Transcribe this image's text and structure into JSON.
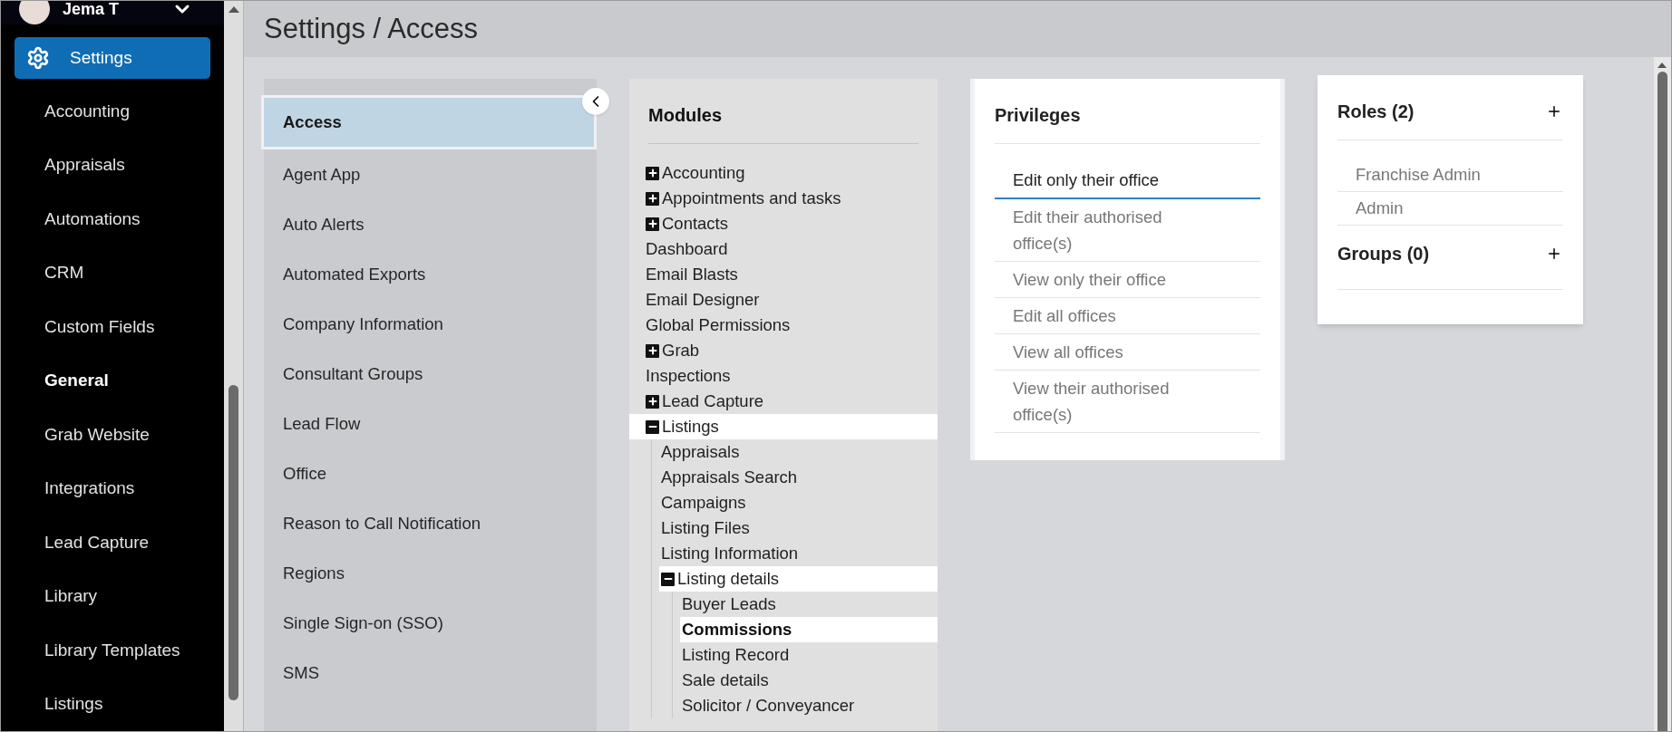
{
  "user": {
    "name": "Jema T"
  },
  "nav": {
    "header": {
      "label": "Settings",
      "selected": true
    },
    "items": [
      {
        "label": "Accounting",
        "selected": false
      },
      {
        "label": "Appraisals",
        "selected": false
      },
      {
        "label": "Automations",
        "selected": false
      },
      {
        "label": "CRM",
        "selected": false
      },
      {
        "label": "Custom Fields",
        "selected": false
      },
      {
        "label": "General",
        "selected": true
      },
      {
        "label": "Grab Website",
        "selected": false
      },
      {
        "label": "Integrations",
        "selected": false
      },
      {
        "label": "Lead Capture",
        "selected": false
      },
      {
        "label": "Library",
        "selected": false
      },
      {
        "label": "Library Templates",
        "selected": false
      },
      {
        "label": "Listings",
        "selected": false
      }
    ]
  },
  "page": {
    "title": "Settings / Access"
  },
  "settings_menu": {
    "items": [
      {
        "label": "Access",
        "selected": true
      },
      {
        "label": "Agent App",
        "selected": false
      },
      {
        "label": "Auto Alerts",
        "selected": false
      },
      {
        "label": "Automated Exports",
        "selected": false
      },
      {
        "label": "Company Information",
        "selected": false
      },
      {
        "label": "Consultant Groups",
        "selected": false
      },
      {
        "label": "Lead Flow",
        "selected": false
      },
      {
        "label": "Office",
        "selected": false
      },
      {
        "label": "Reason to Call Notification",
        "selected": false
      },
      {
        "label": "Regions",
        "selected": false
      },
      {
        "label": "Single Sign-on (SSO)",
        "selected": false
      },
      {
        "label": "SMS",
        "selected": false
      }
    ]
  },
  "modules": {
    "title": "Modules",
    "tree": [
      {
        "label": "Accounting",
        "expanded": false,
        "highlighted": false,
        "selected": false
      },
      {
        "label": "Appointments and tasks",
        "expanded": false,
        "highlighted": false,
        "selected": false
      },
      {
        "label": "Contacts",
        "expanded": false,
        "highlighted": false,
        "selected": false
      },
      {
        "label": "Dashboard",
        "highlighted": false,
        "selected": false
      },
      {
        "label": "Email Blasts",
        "highlighted": false,
        "selected": false
      },
      {
        "label": "Email Designer",
        "highlighted": false,
        "selected": false
      },
      {
        "label": "Global Permissions",
        "highlighted": false,
        "selected": false
      },
      {
        "label": "Grab",
        "expanded": false,
        "highlighted": false,
        "selected": false
      },
      {
        "label": "Inspections",
        "highlighted": false,
        "selected": false
      },
      {
        "label": "Lead Capture",
        "expanded": false,
        "highlighted": false,
        "selected": false
      },
      {
        "label": "Listings",
        "expanded": true,
        "highlighted": true,
        "selected": false,
        "children": [
          {
            "label": "Appraisals",
            "highlighted": false,
            "selected": false
          },
          {
            "label": "Appraisals Search",
            "highlighted": false,
            "selected": false
          },
          {
            "label": "Campaigns",
            "highlighted": false,
            "selected": false
          },
          {
            "label": "Listing Files",
            "highlighted": false,
            "selected": false
          },
          {
            "label": "Listing Information",
            "highlighted": false,
            "selected": false
          },
          {
            "label": "Listing details",
            "expanded": true,
            "highlighted": true,
            "selected": false,
            "children": [
              {
                "label": "Buyer Leads",
                "highlighted": false,
                "selected": false
              },
              {
                "label": "Commissions",
                "highlighted": true,
                "selected": true
              },
              {
                "label": "Listing Record",
                "highlighted": false,
                "selected": false
              },
              {
                "label": "Sale details",
                "highlighted": false,
                "selected": false
              },
              {
                "label": "Solicitor / Conveyancer",
                "highlighted": false,
                "selected": false
              }
            ]
          }
        ]
      }
    ]
  },
  "privileges": {
    "title": "Privileges",
    "items": [
      {
        "label": "Edit only their office",
        "selected": true
      },
      {
        "label": "Edit their authorised office(s)",
        "selected": false
      },
      {
        "label": "View only their office",
        "selected": false
      },
      {
        "label": "Edit all offices",
        "selected": false
      },
      {
        "label": "View all offices",
        "selected": false
      },
      {
        "label": "View their authorised office(s)",
        "selected": false
      }
    ]
  },
  "roles": {
    "title": "Roles (2)",
    "items": [
      "Franchise Admin",
      "Admin"
    ]
  },
  "groups": {
    "title": "Groups (0)"
  }
}
